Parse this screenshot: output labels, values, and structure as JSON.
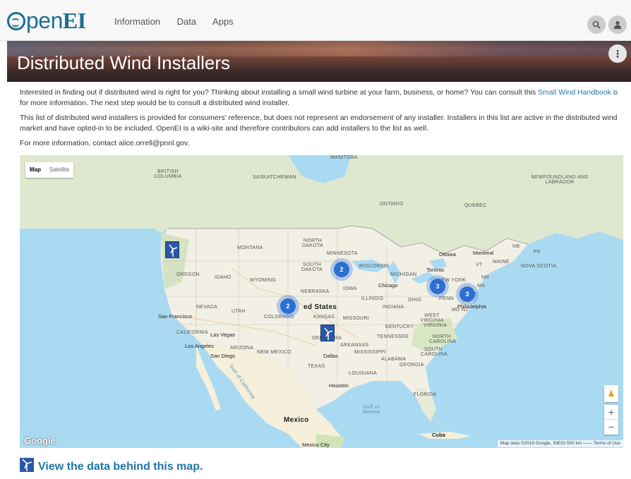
{
  "nav": {
    "logo_left": "pen",
    "logo_right": "EI",
    "links": [
      "Information",
      "Data",
      "Apps"
    ],
    "search_icon": "search-icon",
    "user_icon": "user-icon"
  },
  "hero": {
    "title": "Distributed Wind Installers"
  },
  "intro": {
    "p1_before": "Interested in finding out if distributed wind is right for you? Thinking about installing a small wind turbine at your farm, business, or home? You can consult this ",
    "p1_link": "Small Wind Handbook",
    "p1_after": " for more information. The next step would be to consult a distributed wind installer.",
    "p2": "This list of distributed wind installers is provided for consumers' reference, but does not represent an endorsement of any installer. Installers in this list are active in the distributed wind market and have opted-in to be included. OpenEI is a wiki-site and therefore contributors can add installers to the list as well.",
    "p3": "For more information, contact alice.orrell@pnnl.gov."
  },
  "map": {
    "type_buttons": [
      "Map",
      "Satellite"
    ],
    "labels": {
      "manitoba": "MANITOBA",
      "bc": "BRITISH COLUMBIA",
      "sask": "SASKATCHEWAN",
      "ontario": "ONTARIO",
      "quebec": "QUEBEC",
      "nfl": "NEWFOUNDLAND AND LABRADOR",
      "nd": "NORTH DAKOTA",
      "montana": "MONTANA",
      "mn": "MINNESOTA",
      "sd": "SOUTH DAKOTA",
      "wi": "WISCONSIN",
      "mi": "MICHIGAN",
      "oregon": "OREGON",
      "idaho": "IDAHO",
      "wy": "WYOMING",
      "ne": "NEBRASKA",
      "iowa": "IOWA",
      "il": "ILLINOIS",
      "in": "INDIANA",
      "oh": "OHIO",
      "nv": "NEVADA",
      "ut": "UTAH",
      "co": "COLORADO",
      "ks": "KANSAS",
      "mo": "MISSOURI",
      "ca": "CALIFORNIA",
      "az": "ARIZONA",
      "nm": "NEW MEXICO",
      "ok": "OKLAHOMA",
      "ar": "ARKANSAS",
      "tn": "TENNESSEE",
      "ky": "KENTUCKY",
      "wv": "WEST VIRGINIA",
      "va": "VIRGINIA",
      "nc": "NORTH CAROLINA",
      "sc": "SOUTH CAROLINA",
      "ga": "GEORGIA",
      "al": "ALABAMA",
      "ms": "MISSISSIPPI",
      "la": "LOUISIANA",
      "tx": "TEXAS",
      "fl": "FLORIDA",
      "penn": "PENN",
      "ny": "NEW YORK",
      "vt": "VT",
      "me": "MAINE",
      "nb": "NB",
      "pe": "PE",
      "ns": "NOVA SCOTIA",
      "md": "MD",
      "nj": "NJ",
      "ma": "MA",
      "ct": "CT",
      "nh": "NH",
      "us": "ed States",
      "mexico": "Mexico",
      "cuba": "Cuba",
      "gulf": "Gulf of Mexico",
      "gulf_ca": "Gulf of California"
    },
    "cities": {
      "sf": "San Francisco",
      "lv": "Las Vegas",
      "la": "Los Angeles",
      "sd": "San Diego",
      "dallas": "Dallas",
      "houston": "Houston",
      "chicago": "Chicago",
      "toronto": "Toronto",
      "ottawa": "Ottawa",
      "montreal": "Montreal",
      "philly": "Philadelphia",
      "mexico_city": "Mexico City"
    },
    "clusters": [
      "2",
      "2",
      "3",
      "3"
    ],
    "google": "Google",
    "attribution": "Map data ©2018 Google, INEGI   500 km ⎯⎯⎯⎯   Terms of Use",
    "zoom_in": "+",
    "zoom_out": "−"
  },
  "footer": {
    "link": "View the data behind this map."
  }
}
